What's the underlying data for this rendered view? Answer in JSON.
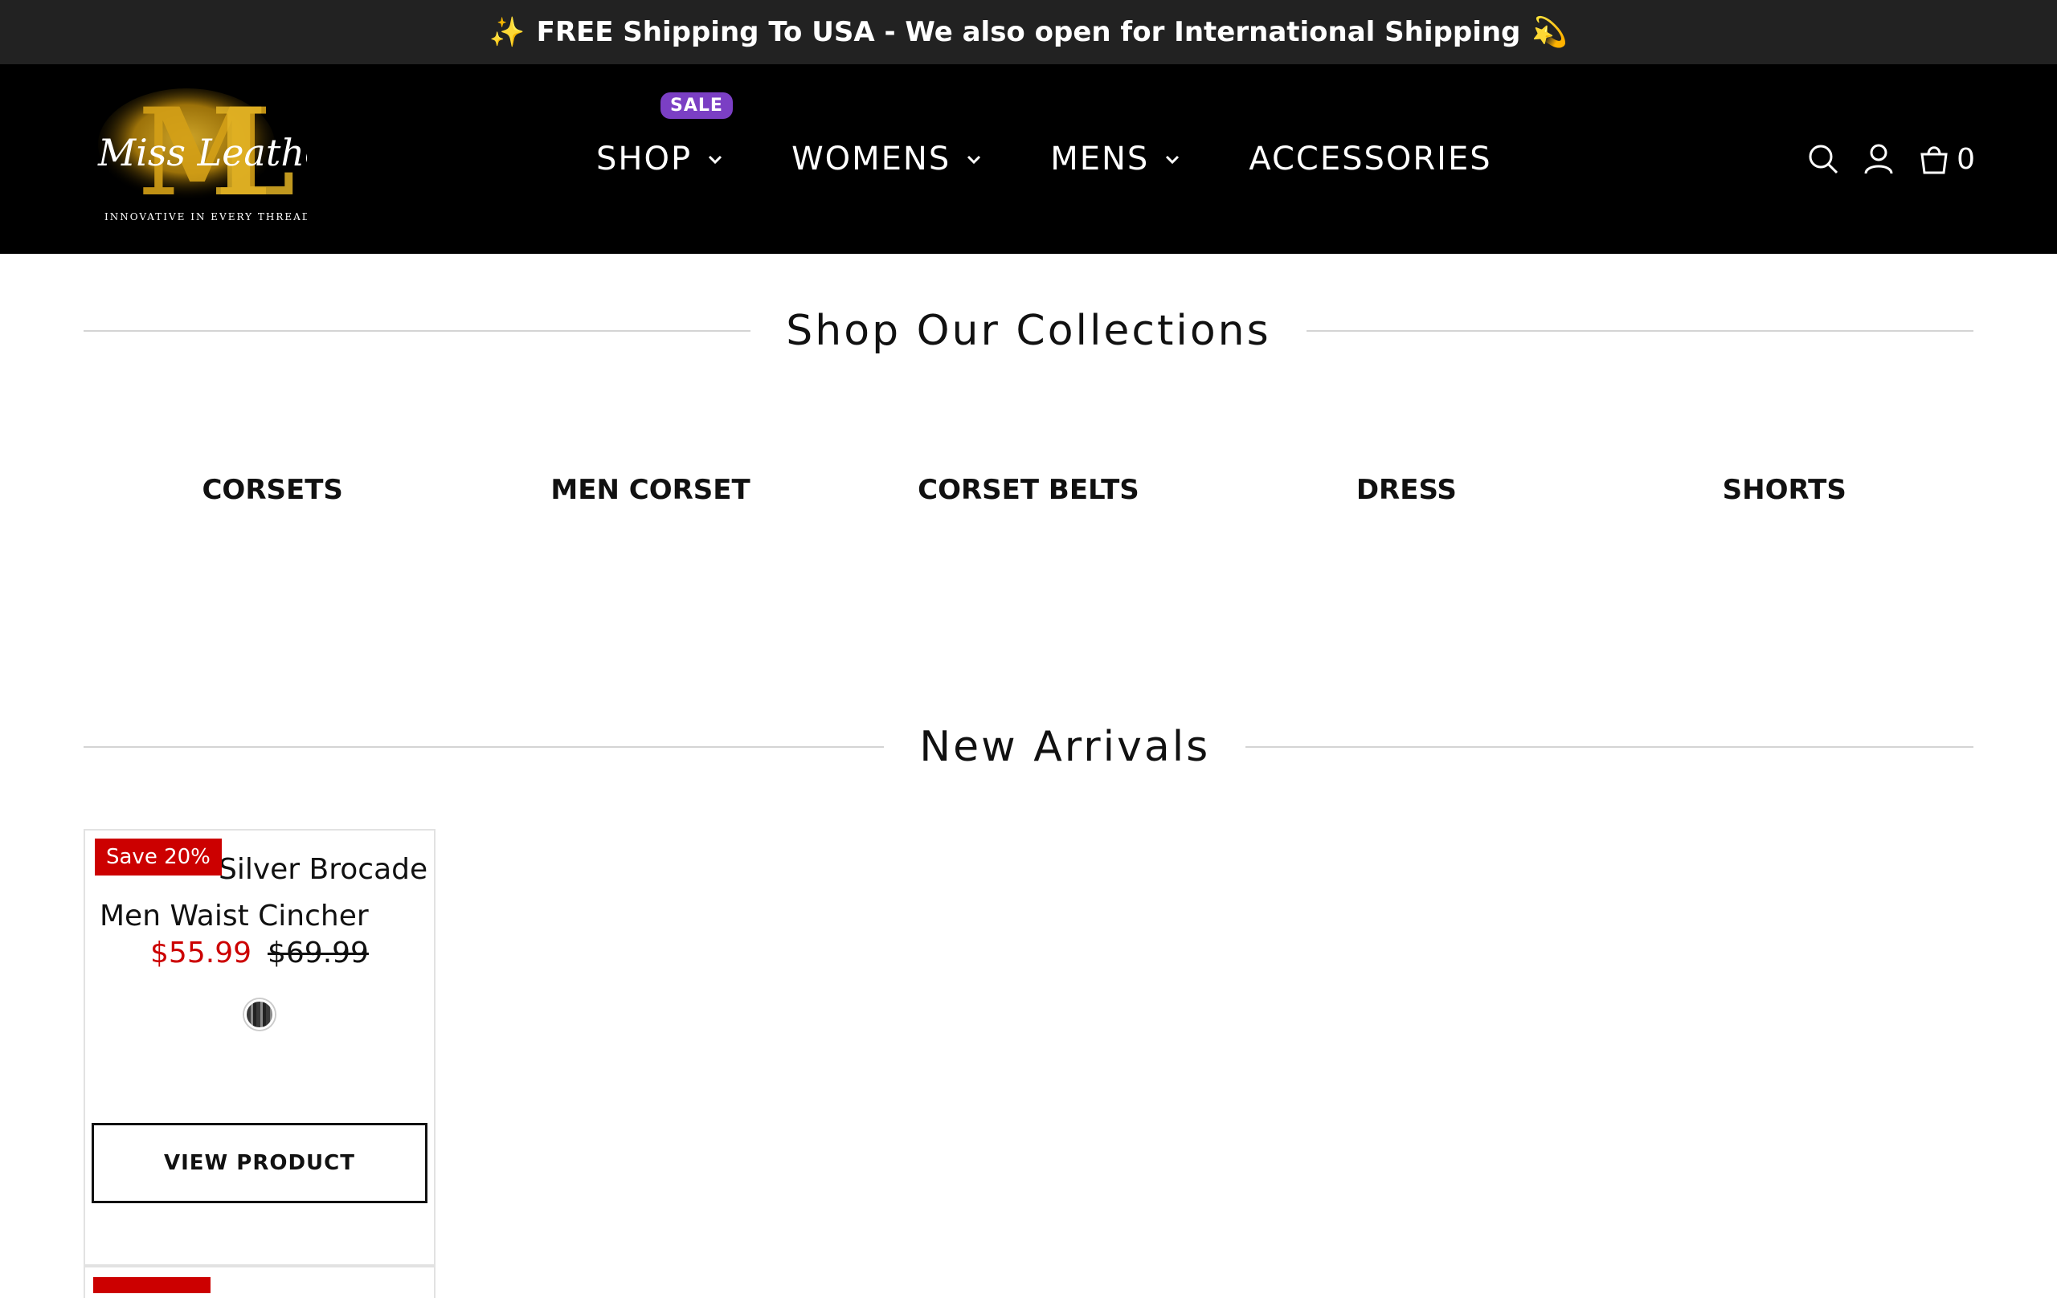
{
  "announcement": {
    "text": "FREE Shipping To USA - We also open for International Shipping",
    "lead_emoji": "✨",
    "trail_emoji": "💫"
  },
  "header": {
    "logo_text": "Miss Leather",
    "logo_tagline": "INNOVATIVE IN EVERY THREAD",
    "nav": [
      {
        "label": "SHOP",
        "badge": "SALE",
        "has_dropdown": true
      },
      {
        "label": "WOMENS",
        "has_dropdown": true
      },
      {
        "label": "MENS",
        "has_dropdown": true
      },
      {
        "label": "ACCESSORIES",
        "has_dropdown": false
      }
    ],
    "cart_count": "0",
    "icons": [
      "search-icon",
      "account-icon",
      "cart-icon"
    ]
  },
  "collections": {
    "title": "Shop Our Collections",
    "items": [
      "CORSETS",
      "MEN CORSET",
      "CORSET BELTS",
      "DRESS",
      "SHORTS"
    ]
  },
  "new_arrivals": {
    "title": "New Arrivals",
    "products": [
      {
        "title": "Silver Brocade Men Waist Cincher",
        "badge": "Save 20%",
        "price_sale": "$55.99",
        "price_original": "$69.99",
        "button_label": "VIEW PRODUCT"
      }
    ]
  },
  "colors": {
    "sale_red": "#cc0000",
    "badge_purple": "#7b3fc4",
    "header_bg": "#000000",
    "announce_bg": "#222222"
  }
}
